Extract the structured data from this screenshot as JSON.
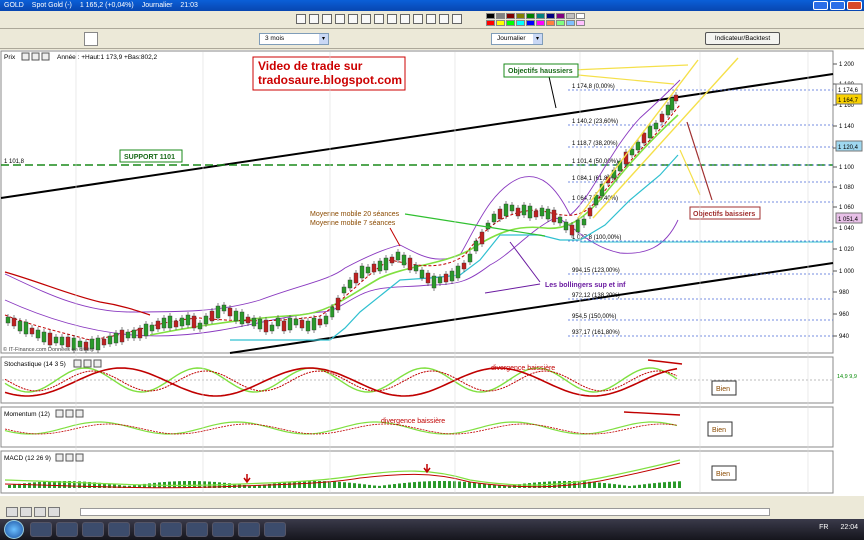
{
  "titlebar": {
    "symbol": "GOLD",
    "instrument": "Spot Gold (-)",
    "price": "1 165,2 (+0,04%)",
    "period": "Journalier",
    "time": "21:03"
  },
  "toolbar": {
    "period_select": "3 mois",
    "scale_select": "Journalier",
    "indicator_button": "Indicateur/Backtest"
  },
  "price_panel": {
    "title": "Prix",
    "info": "Année : +Haut:1 173,9 +Bas:802,2",
    "watermark_1": "Video de trade sur",
    "watermark_2": "tradosaure.blogspot.com",
    "copyright": "© IT-Finance.com  Données en différé",
    "support_label": "SUPPORT 1101",
    "support_value": "1 101,8",
    "objectifs_haussiers": "Objectifs haussiers",
    "objectifs_baissiers": "Objectifs baissiers",
    "ma_label_1": "Moyenne mobile 20 séances",
    "ma_label_2": "Moyenne mobile 7 séances",
    "bollinger_label": "Les bollingers sup et inf",
    "fib_levels": [
      "1 174,8 (0,00%)",
      "1 140,2 (23,60%)",
      "1 118,7 (38,20%)",
      "1 101,4 (50,00%)",
      "1 084,1 (61,80%)",
      "1 064,7 (76,40%)",
      "1 027,8 (100,00%)",
      "994,15 (123,00%)",
      "972,12 (138,20%)",
      "954,5 (150,00%)",
      "937,17 (161,80%)"
    ],
    "y_ticks": [
      "1 200",
      "1 180",
      "1 160",
      "1 140",
      "1 120",
      "1 100",
      "1 080",
      "1 060",
      "1 040",
      "1 020",
      "1 000",
      "980",
      "960",
      "940"
    ],
    "right_badges": [
      "1 174,6",
      "1 164,7",
      "1 120,4",
      "1 051,4"
    ]
  },
  "stoch_panel": {
    "title": "Stochastique (14 3 5)",
    "note": "divergence baissière",
    "verdict": "Bien",
    "value": "14,9 9,9"
  },
  "momentum_panel": {
    "title": "Momentum (12)",
    "note": "divergence baissière",
    "verdict": "Bien"
  },
  "macd_panel": {
    "title": "MACD (12 26 9)",
    "verdict": "Bien"
  },
  "x_labels": [
    "Jul",
    "Aou",
    "Sep",
    "Oct",
    "Nov",
    "Dec",
    "2010"
  ],
  "taskbar": {
    "lang": "FR",
    "clock": "22:04"
  },
  "colors": {
    "support": "#1a8a1a",
    "trend": "#000000",
    "fib": "#4a6ad8",
    "ma20": "#80e040",
    "ma7": "#c00000",
    "bollinger": "#8a3ac0",
    "objectif_h": "#f5e04a",
    "objectif_b": "#a03030",
    "note": "#c00000"
  }
}
